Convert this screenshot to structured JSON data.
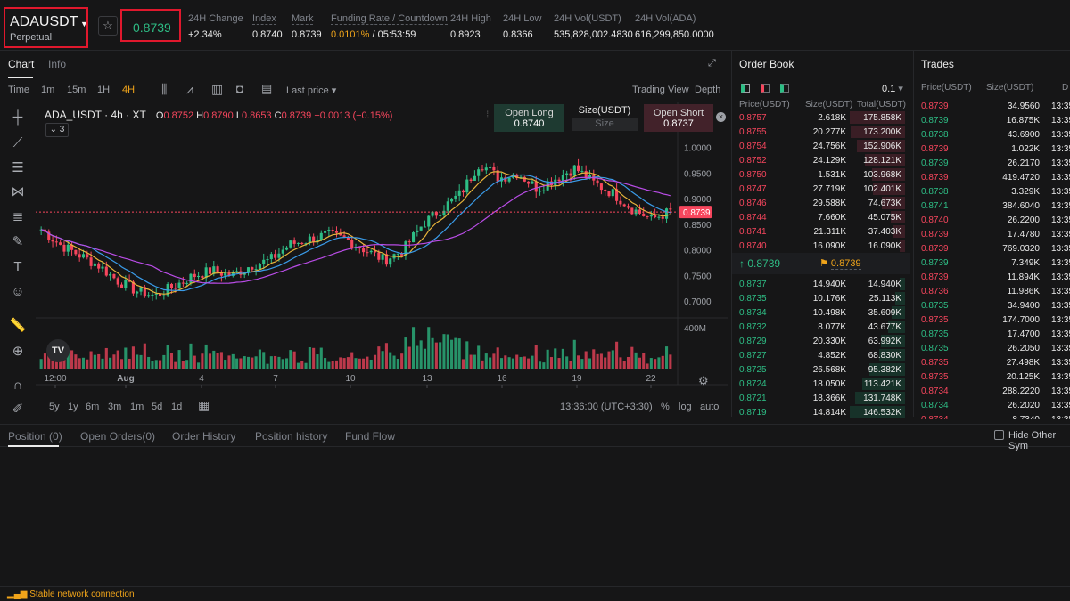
{
  "header": {
    "symbol": "ADAUSDT",
    "contract_type": "Perpetual",
    "last_price": "0.8739",
    "stats": [
      {
        "label": "24H Change",
        "value": "+2.34%",
        "color": "green"
      },
      {
        "label": "Index",
        "value": "0.8740"
      },
      {
        "label": "Mark",
        "value": "0.8739"
      },
      {
        "label": "Funding Rate / Countdown",
        "value_a": "0.0101%",
        "value_b": " / 05:53:59"
      },
      {
        "label": "24H High",
        "value": "0.8923"
      },
      {
        "label": "24H Low",
        "value": "0.8366"
      },
      {
        "label": "24H Vol(USDT)",
        "value": "535,828,002.4830"
      },
      {
        "label": "24H Vol(ADA)",
        "value": "616,299,850.0000"
      }
    ]
  },
  "chart_tabs": {
    "chart": "Chart",
    "info": "Info"
  },
  "toolbar": {
    "intervals": [
      "Time",
      "1m",
      "15m",
      "1H",
      "4H"
    ],
    "active_interval": "4H",
    "price_type": "Last price",
    "trading_view": "Trading View",
    "depth": "Depth"
  },
  "legend": {
    "pair": "ADA_USDT · 4h · XT",
    "o_label": "O",
    "o": "0.8752",
    "h_label": "H",
    "h": "0.8790",
    "l_label": "L",
    "l": "0.8653",
    "c_label": "C",
    "c": "0.8739",
    "change": "−0.0013 (−0.15%)",
    "indicator_count": "3"
  },
  "quick_order": {
    "long_label": "Open Long",
    "long_price": "0.8740",
    "size_label": "Size(USDT)",
    "size_placeholder": "Size",
    "short_label": "Open Short",
    "short_price": "0.8737"
  },
  "chart_data": {
    "type": "candlestick",
    "pair": "ADA_USDT",
    "interval": "4h",
    "x_tick_labels": [
      "12:00",
      "Aug",
      "4",
      "7",
      "10",
      "13",
      "16",
      "19",
      "22"
    ],
    "y_tick_labels": [
      "1.0000",
      "0.9500",
      "0.9000",
      "0.8500",
      "0.8000",
      "0.7500",
      "0.7000"
    ],
    "ylim": [
      0.69,
      1.02
    ],
    "current_price_label": "0.8739",
    "volume_label": "400M",
    "close_path": [
      0.84,
      0.81,
      0.79,
      0.77,
      0.74,
      0.72,
      0.71,
      0.73,
      0.75,
      0.76,
      0.75,
      0.77,
      0.78,
      0.81,
      0.82,
      0.83,
      0.82,
      0.8,
      0.78,
      0.8,
      0.85,
      0.88,
      0.91,
      0.97,
      0.94,
      0.95,
      0.92,
      0.94,
      0.96,
      0.93,
      0.91,
      0.88,
      0.86,
      0.875
    ]
  },
  "period_bar": {
    "periods": [
      "5y",
      "1y",
      "6m",
      "3m",
      "1m",
      "5d",
      "1d"
    ],
    "time": "13:36:00 (UTC+3:30)",
    "percent": "%",
    "log": "log",
    "auto": "auto"
  },
  "order_book": {
    "title": "Order Book",
    "tick_size": "0.1",
    "headers": [
      "Price(USDT)",
      "Size(USDT)",
      "Total(USDT)"
    ],
    "asks": [
      [
        "0.8757",
        "2.618K",
        "175.858K",
        1.0
      ],
      [
        "0.8755",
        "20.277K",
        "173.200K",
        0.98
      ],
      [
        "0.8754",
        "24.756K",
        "152.906K",
        0.87
      ],
      [
        "0.8752",
        "24.129K",
        "128.121K",
        0.73
      ],
      [
        "0.8750",
        "1.531K",
        "103.968K",
        0.59
      ],
      [
        "0.8747",
        "27.719K",
        "102.401K",
        0.58
      ],
      [
        "0.8746",
        "29.588K",
        "74.673K",
        0.42
      ],
      [
        "0.8744",
        "7.660K",
        "45.075K",
        0.26
      ],
      [
        "0.8741",
        "21.311K",
        "37.403K",
        0.21
      ],
      [
        "0.8740",
        "16.090K",
        "16.090K",
        0.09
      ]
    ],
    "mid_price": "0.8739",
    "mark_price": "0.8739",
    "bids": [
      [
        "0.8737",
        "14.940K",
        "14.940K",
        0.1
      ],
      [
        "0.8735",
        "10.176K",
        "25.113K",
        0.17
      ],
      [
        "0.8734",
        "10.498K",
        "35.609K",
        0.24
      ],
      [
        "0.8732",
        "8.077K",
        "43.677K",
        0.3
      ],
      [
        "0.8729",
        "20.330K",
        "63.992K",
        0.44
      ],
      [
        "0.8727",
        "4.852K",
        "68.830K",
        0.47
      ],
      [
        "0.8725",
        "26.568K",
        "95.382K",
        0.65
      ],
      [
        "0.8724",
        "18.050K",
        "113.421K",
        0.77
      ],
      [
        "0.8721",
        "18.366K",
        "131.748K",
        0.9
      ],
      [
        "0.8719",
        "14.814K",
        "146.532K",
        1.0
      ]
    ]
  },
  "trades": {
    "title": "Trades",
    "headers": [
      "Price(USDT)",
      "Size(USDT)",
      "D"
    ],
    "rows": [
      [
        "0.8739",
        "34.9560",
        "red"
      ],
      [
        "0.8739",
        "16.875K",
        "green"
      ],
      [
        "0.8738",
        "43.6900",
        "green"
      ],
      [
        "0.8739",
        "1.022K",
        "red"
      ],
      [
        "0.8739",
        "26.2170",
        "green"
      ],
      [
        "0.8739",
        "419.4720",
        "red"
      ],
      [
        "0.8738",
        "3.329K",
        "green"
      ],
      [
        "0.8741",
        "384.6040",
        "green"
      ],
      [
        "0.8740",
        "26.2200",
        "red"
      ],
      [
        "0.8739",
        "17.4780",
        "red"
      ],
      [
        "0.8739",
        "769.0320",
        "red"
      ],
      [
        "0.8739",
        "7.349K",
        "green"
      ],
      [
        "0.8739",
        "11.894K",
        "red"
      ],
      [
        "0.8736",
        "11.986K",
        "red"
      ],
      [
        "0.8735",
        "34.9400",
        "green"
      ],
      [
        "0.8735",
        "174.7000",
        "red"
      ],
      [
        "0.8735",
        "17.4700",
        "green"
      ],
      [
        "0.8735",
        "26.2050",
        "green"
      ],
      [
        "0.8735",
        "27.498K",
        "red"
      ],
      [
        "0.8735",
        "20.125K",
        "red"
      ],
      [
        "0.8734",
        "288.2220",
        "red"
      ],
      [
        "0.8734",
        "26.2020",
        "green"
      ],
      [
        "0.8734",
        "8.7340",
        "red"
      ]
    ],
    "time_col": "13:35"
  },
  "positions": {
    "tabs": [
      "Position (0)",
      "Open Orders(0)",
      "Order History",
      "Position history",
      "Fund Flow"
    ],
    "hide_other": "Hide Other Sym"
  },
  "status": {
    "text": "Stable network connection"
  }
}
